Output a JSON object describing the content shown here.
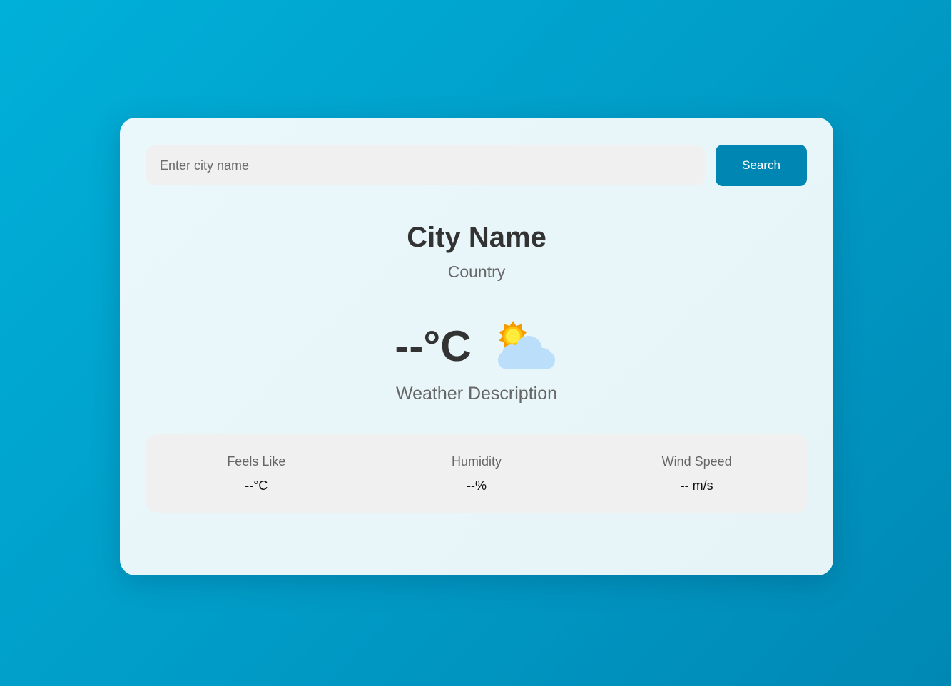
{
  "search": {
    "placeholder": "Enter city name",
    "value": "",
    "button_label": "Search"
  },
  "location": {
    "city": "City Name",
    "country": "Country"
  },
  "weather": {
    "temperature": "--°C",
    "icon": "partly-cloudy-icon",
    "description": "Weather Description"
  },
  "details": [
    {
      "label": "Feels Like",
      "value": "--°C"
    },
    {
      "label": "Humidity",
      "value": "--%"
    },
    {
      "label": "Wind Speed",
      "value": "-- m/s"
    }
  ],
  "colors": {
    "background_start": "#00b0d8",
    "background_end": "#0088b4",
    "card": "#e8f6fa",
    "accent": "#0086b3",
    "panel": "#f0f0f0",
    "text_primary": "#333333",
    "text_secondary": "#666666"
  }
}
